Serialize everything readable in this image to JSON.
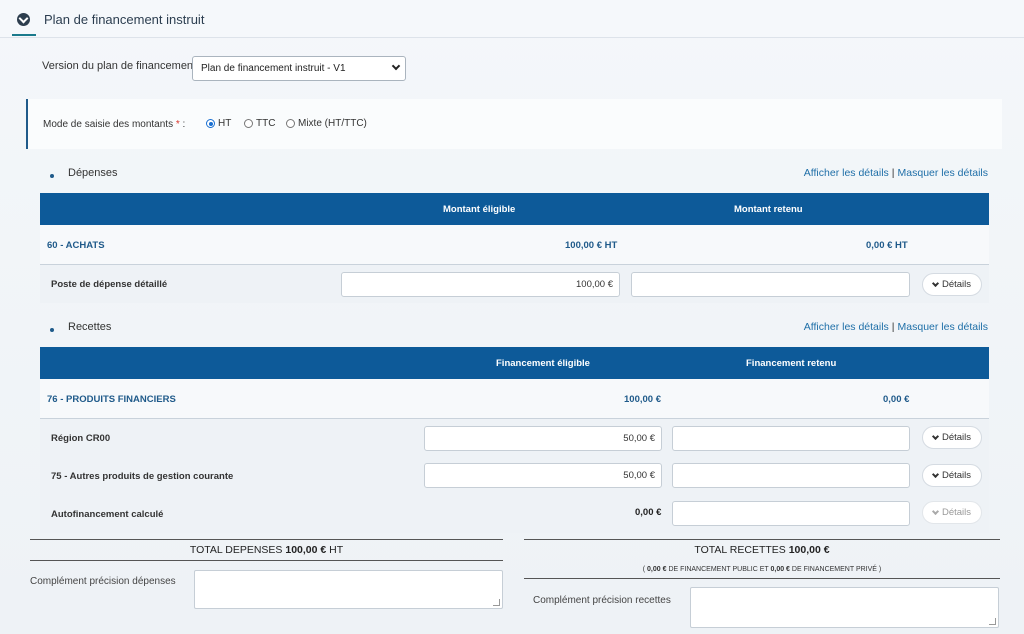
{
  "panel": {
    "title": "Plan de financement instruit"
  },
  "version": {
    "label": "Version du plan de financement",
    "selected": "Plan de financement instruit - V1"
  },
  "mode": {
    "label": "Mode de saisie des montants",
    "required_mark": "*",
    "colon": ":",
    "options": [
      {
        "label": "HT",
        "selected": true
      },
      {
        "label": "TTC",
        "selected": false
      },
      {
        "label": "Mixte (HT/TTC)",
        "selected": false
      }
    ]
  },
  "links": {
    "show": "Afficher les détails",
    "separator": "|",
    "hide": "Masquer les détails"
  },
  "depenses": {
    "title": "Dépenses",
    "headers": [
      "Montant éligible",
      "Montant retenu"
    ],
    "category": {
      "name": "60 - ACHATS",
      "eligible": "100,00 €  HT",
      "retained": "0,00 €  HT"
    },
    "rows": [
      {
        "label": "Poste de dépense détaillé",
        "eligible": "100,00 €",
        "retained": "",
        "details": "Détails"
      }
    ]
  },
  "recettes": {
    "title": "Recettes",
    "headers": [
      "Financement éligible",
      "Financement retenu"
    ],
    "category": {
      "name": "76 - PRODUITS FINANCIERS",
      "eligible": "100,00 €",
      "retained": "0,00 €"
    },
    "rows": [
      {
        "label": "Région CR00",
        "eligible": "50,00 €",
        "retained": "",
        "details": "Détails"
      },
      {
        "label": "75 - Autres produits de gestion courante",
        "eligible": "50,00 €",
        "retained": "",
        "details": "Détails"
      },
      {
        "label": "Autofinancement calculé",
        "eligible": "0,00 €",
        "retained": "",
        "details": "Détails"
      }
    ]
  },
  "totals": {
    "depenses_prefix": "TOTAL DEPENSES",
    "depenses_value": "100,00 €",
    "depenses_suffix": "HT",
    "recettes_prefix": "TOTAL RECETTES",
    "recettes_value": "100,00 €",
    "note_open": "(",
    "public_value": "0,00 €",
    "public_text": "DE FINANCEMENT PUBLIC ET",
    "private_value": "0,00 €",
    "private_text": "DE FINANCEMENT PRIVÉ",
    "note_close": ")"
  },
  "complements": {
    "depenses_label": "Complément précision dépenses",
    "recettes_label": "Complément précision recettes"
  }
}
